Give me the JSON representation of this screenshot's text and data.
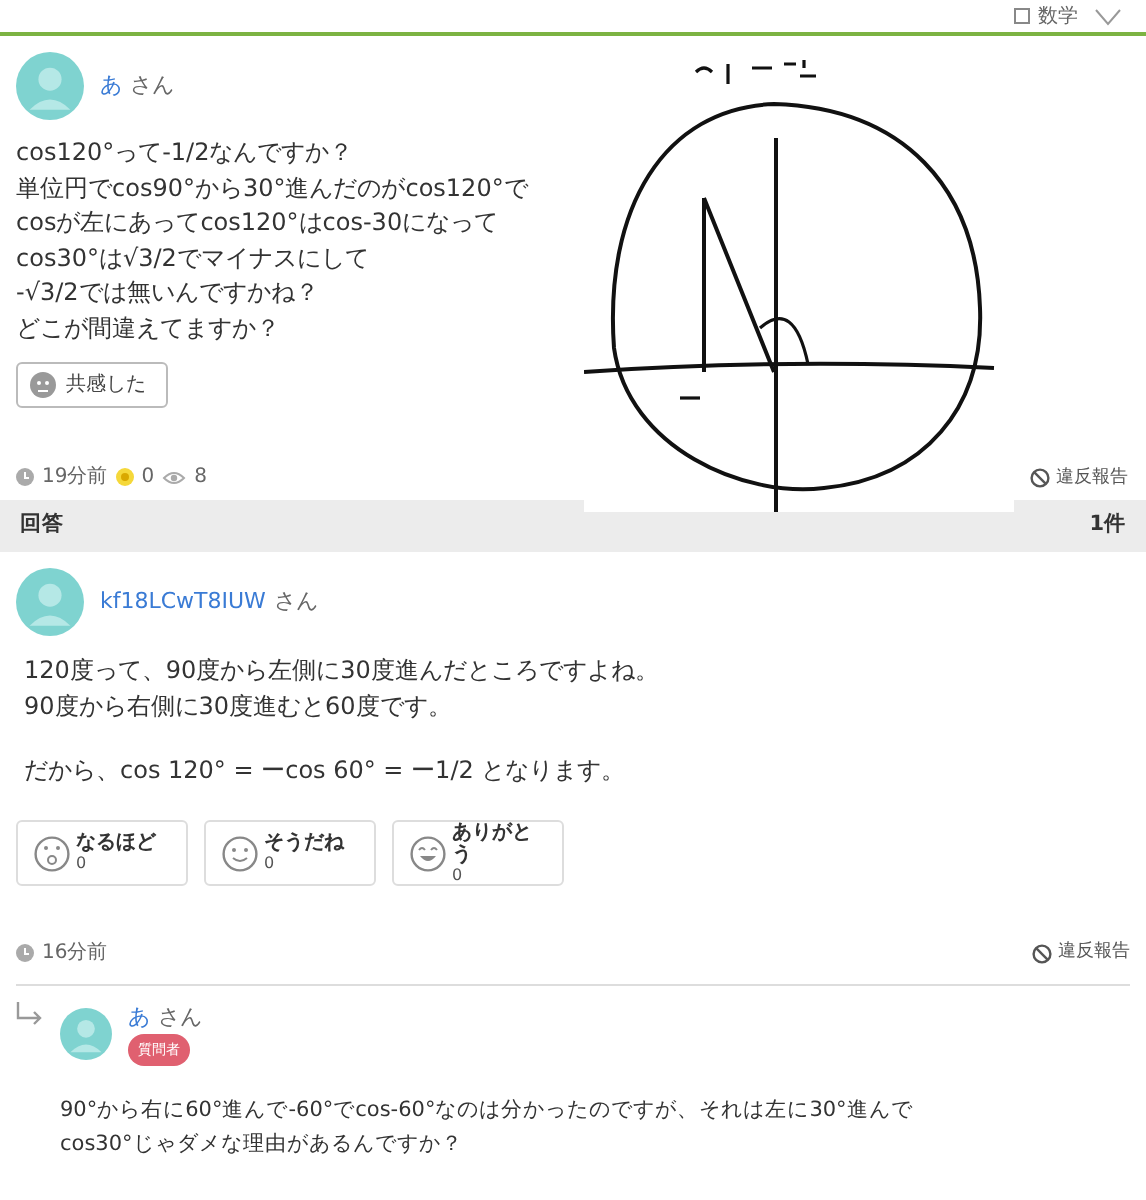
{
  "header": {
    "category": "数学"
  },
  "question": {
    "user": {
      "name": "あ",
      "suffix": "さん"
    },
    "lines": [
      "cos120°って-1/2なんですか？",
      "単位円でcos90°から30°進んだのがcos120°で",
      "cosが左にあってcos120°はcos-30になって",
      "cos30°は√3/2でマイナスにして",
      "-√3/2では無いんですかね？",
      "どこが間違えてますか？"
    ],
    "empathy_button": "共感した",
    "time": "19分前",
    "coins": "0",
    "views": "8",
    "report": "違反報告"
  },
  "answers_header": {
    "title": "回答",
    "count": "1件"
  },
  "answer": {
    "user": {
      "name": "kf18LCwT8IUW",
      "suffix": "さん"
    },
    "paragraphs": [
      "120度って、90度から左側に30度進んだところですよね。\n90度から右側に30度進むと60度です。",
      "だから、cos 120° = ーcos 60° = ー1/2 となります。"
    ],
    "reactions": [
      {
        "kind": "wow",
        "label": "なるほど",
        "count": "0"
      },
      {
        "kind": "smile",
        "label": "そうだね",
        "count": "0"
      },
      {
        "kind": "grin",
        "label": "ありがとう",
        "count": "0"
      }
    ],
    "time": "16分前",
    "report": "違反報告"
  },
  "reply": {
    "user": {
      "name": "あ",
      "suffix": "さん"
    },
    "badge": "質問者",
    "text": "90°から右に60°進んで-60°でcos-60°なのは分かったのですが、それは左に30°進んでcos30°じゃダメな理由があるんですか？"
  }
}
